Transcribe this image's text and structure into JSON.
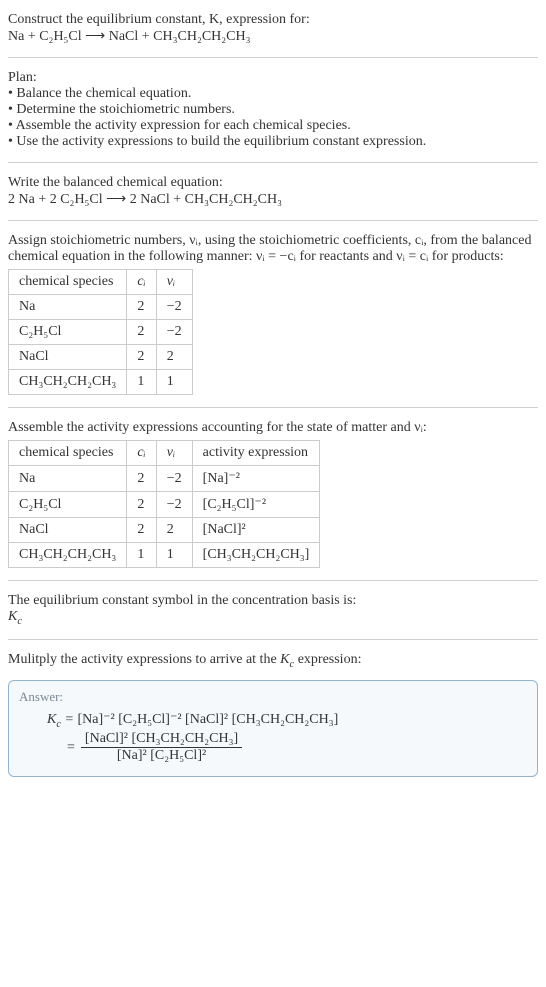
{
  "s1": {
    "l1": "Construct the equilibrium constant, K, expression for:",
    "l2": "Na + C₂H₅Cl  ⟶  NaCl + CH₃CH₂CH₂CH₃"
  },
  "s2": {
    "title": "Plan:",
    "b1": "• Balance the chemical equation.",
    "b2": "• Determine the stoichiometric numbers.",
    "b3": "• Assemble the activity expression for each chemical species.",
    "b4": "• Use the activity expressions to build the equilibrium constant expression."
  },
  "s3": {
    "l1": "Write the balanced chemical equation:",
    "l2": "2 Na + 2 C₂H₅Cl  ⟶  2 NaCl + CH₃CH₂CH₂CH₃"
  },
  "s4": {
    "intro": "Assign stoichiometric numbers, νᵢ, using the stoichiometric coefficients, cᵢ, from the balanced chemical equation in the following manner: νᵢ = −cᵢ for reactants and νᵢ = cᵢ for products:",
    "h1": "chemical species",
    "h2": "cᵢ",
    "h3": "νᵢ",
    "rows": [
      {
        "sp": "Na",
        "c": "2",
        "v": "−2"
      },
      {
        "sp": "C₂H₅Cl",
        "c": "2",
        "v": "−2"
      },
      {
        "sp": "NaCl",
        "c": "2",
        "v": "2"
      },
      {
        "sp": "CH₃CH₂CH₂CH₃",
        "c": "1",
        "v": "1"
      }
    ]
  },
  "s5": {
    "intro": "Assemble the activity expressions accounting for the state of matter and νᵢ:",
    "h1": "chemical species",
    "h2": "cᵢ",
    "h3": "νᵢ",
    "h4": "activity expression",
    "rows": [
      {
        "sp": "Na",
        "c": "2",
        "v": "−2",
        "a": "[Na]⁻²"
      },
      {
        "sp": "C₂H₅Cl",
        "c": "2",
        "v": "−2",
        "a": "[C₂H₅Cl]⁻²"
      },
      {
        "sp": "NaCl",
        "c": "2",
        "v": "2",
        "a": "[NaCl]²"
      },
      {
        "sp": "CH₃CH₂CH₂CH₃",
        "c": "1",
        "v": "1",
        "a": "[CH₃CH₂CH₂CH₃]"
      }
    ]
  },
  "s6": {
    "l1": "The equilibrium constant symbol in the concentration basis is:",
    "l2": "K_c"
  },
  "s7": {
    "l1": "Mulitply the activity expressions to arrive at the K_c expression:"
  },
  "ans": {
    "label": "Answer:",
    "line1_lhs": "K_c = ",
    "line1_rhs": "[Na]⁻² [C₂H₅Cl]⁻² [NaCl]² [CH₃CH₂CH₂CH₃]",
    "eq": "= ",
    "num": "[NaCl]² [CH₃CH₂CH₂CH₃]",
    "den": "[Na]² [C₂H₅Cl]²"
  },
  "chart_data": {
    "type": "table",
    "tables": [
      {
        "title": "Stoichiometric numbers",
        "columns": [
          "chemical species",
          "cᵢ",
          "νᵢ"
        ],
        "rows": [
          [
            "Na",
            2,
            -2
          ],
          [
            "C₂H₅Cl",
            2,
            -2
          ],
          [
            "NaCl",
            2,
            2
          ],
          [
            "CH₃CH₂CH₂CH₃",
            1,
            1
          ]
        ]
      },
      {
        "title": "Activity expressions",
        "columns": [
          "chemical species",
          "cᵢ",
          "νᵢ",
          "activity expression"
        ],
        "rows": [
          [
            "Na",
            2,
            -2,
            "[Na]^-2"
          ],
          [
            "C₂H₅Cl",
            2,
            -2,
            "[C2H5Cl]^-2"
          ],
          [
            "NaCl",
            2,
            2,
            "[NaCl]^2"
          ],
          [
            "CH₃CH₂CH₂CH₃",
            1,
            1,
            "[CH3CH2CH2CH3]"
          ]
        ]
      }
    ]
  }
}
